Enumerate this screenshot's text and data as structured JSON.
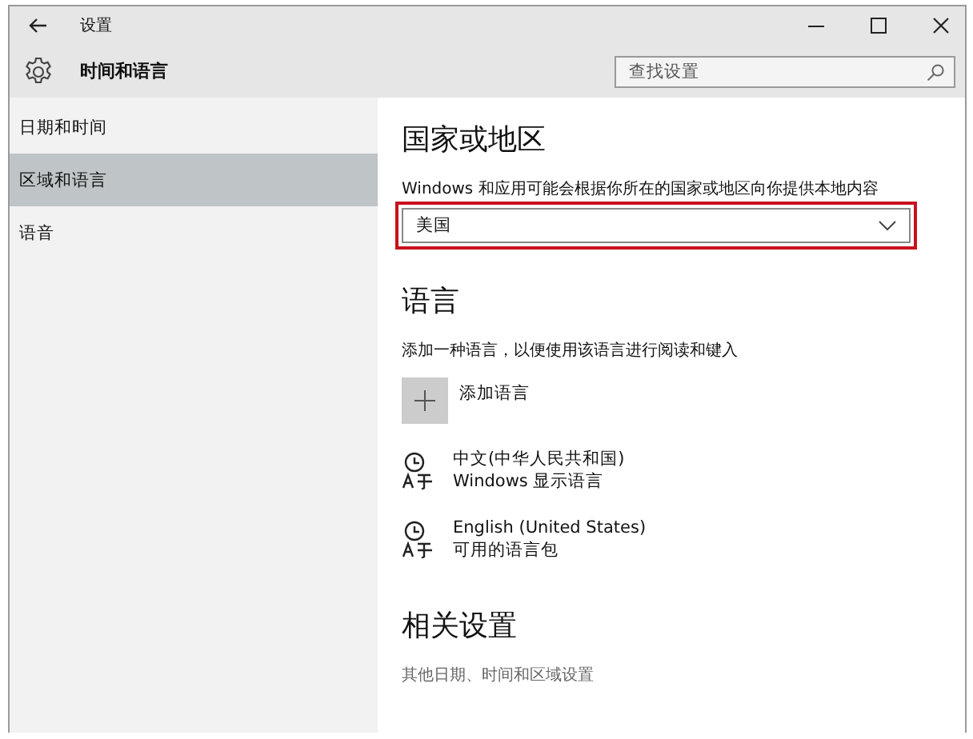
{
  "window": {
    "title": "设置"
  },
  "header": {
    "title": "时间和语言",
    "search": {
      "placeholder": "查找设置"
    }
  },
  "sidebar": {
    "items": [
      {
        "label": "日期和时间",
        "selected": false
      },
      {
        "label": "区域和语言",
        "selected": true
      },
      {
        "label": "语音",
        "selected": false
      }
    ]
  },
  "region": {
    "heading": "国家或地区",
    "description": "Windows 和应用可能会根据你所在的国家或地区向你提供本地内容",
    "dropdown": {
      "value": "美国",
      "highlighted": true
    }
  },
  "language": {
    "heading": "语言",
    "description": "添加一种语言，以便使用该语言进行阅读和键入",
    "add_label": "添加语言",
    "languages": [
      {
        "name": "中文(中华人民共和国)",
        "detail": "Windows 显示语言"
      },
      {
        "name": "English (United States)",
        "detail": "可用的语言包"
      }
    ]
  },
  "related": {
    "heading": "相关设置",
    "links": [
      "其他日期、时间和区域设置"
    ]
  }
}
